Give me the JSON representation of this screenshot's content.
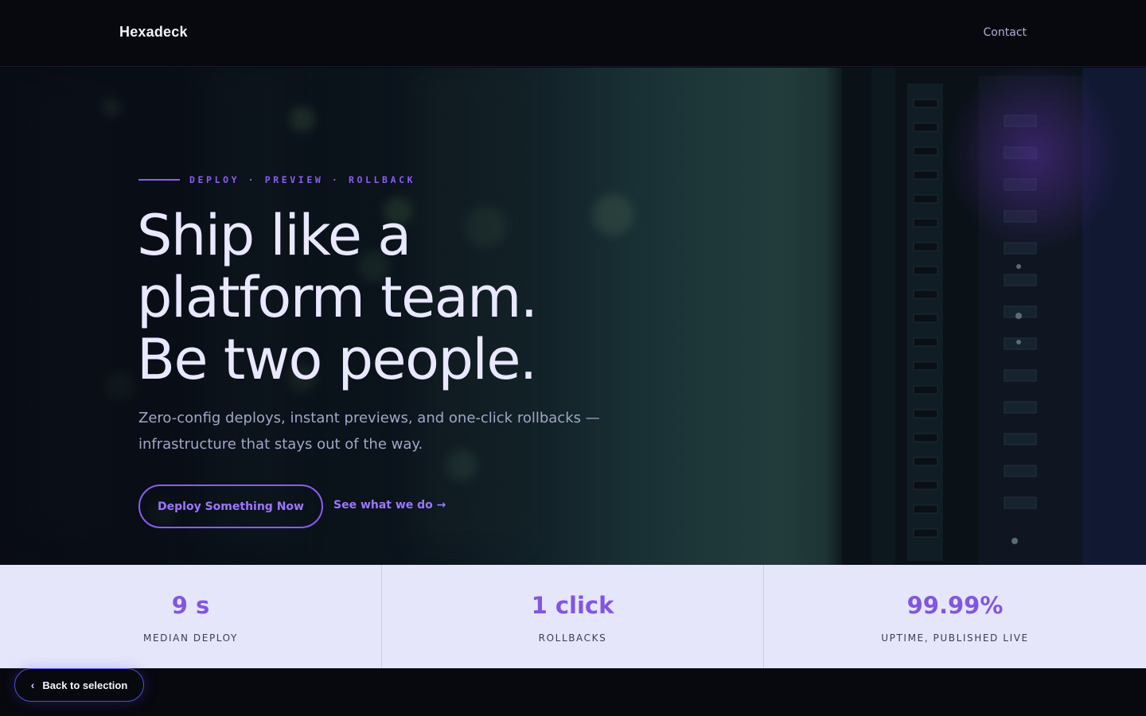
{
  "header": {
    "logo": "Hexadeck",
    "nav": {
      "contact": "Contact"
    }
  },
  "hero": {
    "eyebrow": "DEPLOY · PREVIEW · ROLLBACK",
    "headline": [
      "Ship like a",
      "platform team.",
      "Be two people."
    ],
    "subtext": "Zero-config deploys, instant previews, and one-click rollbacks — infrastructure that stays out of the way.",
    "cta_primary": "Deploy Something Now",
    "cta_secondary": "See what we do →"
  },
  "stats": [
    {
      "value": "9 s",
      "label": "MEDIAN DEPLOY"
    },
    {
      "value": "1 click",
      "label": "ROLLBACKS"
    },
    {
      "value": "99.99%",
      "label": "UPTIME, PUBLISHED LIVE"
    }
  ],
  "back_button": {
    "label": "Back to selection",
    "icon": "chevron-left-icon"
  },
  "colors": {
    "accent": "#8b5cf6",
    "background": "#08080f",
    "stats_band": "#e6e6fb",
    "headline": "#e9e8ff"
  }
}
